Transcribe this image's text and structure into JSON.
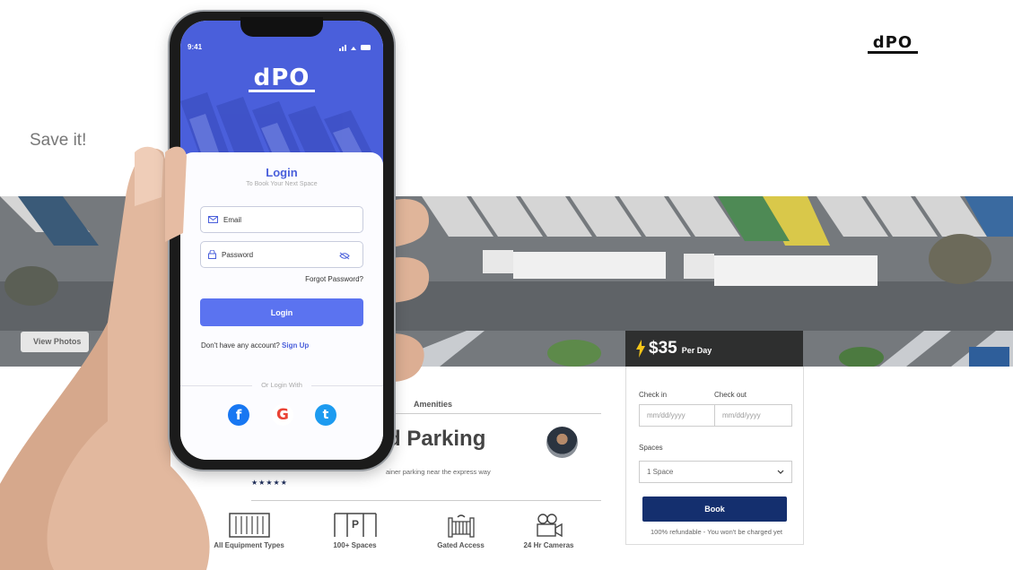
{
  "header": {
    "logo_text": "dPO",
    "tagline": "Save it!"
  },
  "hero": {
    "view_photos_label": "View Photos"
  },
  "listing": {
    "tab_label": "Amenities",
    "title_fragment": "d Parking",
    "description_fragment": "ainer parking near the express way",
    "rating_stars": "★★★★★",
    "amenities": [
      {
        "icon": "container-icon",
        "label": "All Equipment Types"
      },
      {
        "icon": "parking-icon",
        "label": "100+ Spaces"
      },
      {
        "icon": "gate-icon",
        "label": "Gated Access"
      },
      {
        "icon": "camera-icon",
        "label": "24 Hr Cameras"
      }
    ]
  },
  "booking": {
    "price": "$35",
    "per": "Per Day",
    "checkin_label": "Check in",
    "checkout_label": "Check out",
    "checkin_placeholder": "mm/dd/yyyy",
    "checkout_placeholder": "mm/dd/yyyy",
    "spaces_label": "Spaces",
    "spaces_value": "1 Space",
    "book_label": "Book",
    "refund_note": "100% refundable - You won't be charged yet"
  },
  "phone": {
    "time": "9:41",
    "logo_text": "dPO",
    "login_title": "Login",
    "login_subtitle": "To Book Your Next Space",
    "email_placeholder": "Email",
    "password_placeholder": "Password",
    "forgot_label": "Forgot Password?",
    "login_button": "Login",
    "no_account_text": "Don't have any account?",
    "signup_label": "Sign Up",
    "or_login_with": "Or Login With",
    "social": {
      "facebook": "f",
      "google": "G",
      "twitter": "t"
    }
  },
  "colors": {
    "accent": "#5b73f0",
    "book_button": "#142f6e",
    "lightning": "#f5c518"
  }
}
